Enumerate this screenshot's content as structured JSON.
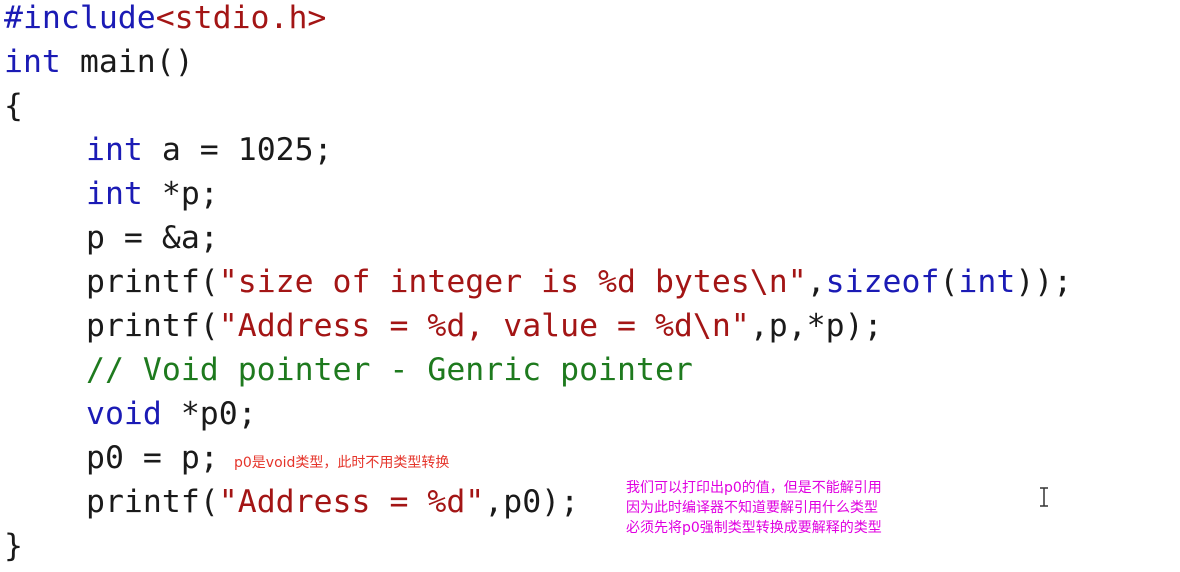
{
  "code": {
    "l1": {
      "directive": "#include",
      "header": "<stdio.h>"
    },
    "l2": {
      "kw": "int",
      "rest": " main()"
    },
    "l3": {
      "text": "{"
    },
    "l4": {
      "kw": "int",
      "rest": " a = 1025;"
    },
    "l5": {
      "kw": "int",
      "rest": " *p;"
    },
    "l6": {
      "text": "p = &a;"
    },
    "l7": {
      "fn": "printf(",
      "str": "\"size of integer is %d bytes\\n\"",
      "mid": ",",
      "kw1": "sizeof",
      "mid2": "(",
      "kw2": "int",
      "end": "));"
    },
    "l8": {
      "fn": "printf(",
      "str": "\"Address = %d, value = %d\\n\"",
      "end": ",p,*p);"
    },
    "l9": {
      "comment": "// Void pointer - Genric pointer"
    },
    "l10": {
      "kw": "void",
      "rest": " *p0;"
    },
    "l11": {
      "text": "p0 = p;"
    },
    "l12": {
      "fn": "printf(",
      "str": "\"Address = %d\"",
      "end": ",p0);"
    },
    "l13": {
      "text": "}"
    }
  },
  "annotations": {
    "red": "p0是void类型，此时不用类型转换",
    "magenta": [
      "我们可以打印出p0的值，但是不能解引用",
      "因为此时编译器不知道要解引用什么类型",
      "必须先将p0强制类型转换成要解释的类型"
    ]
  },
  "colors": {
    "keyword": "#1b1bb5",
    "string": "#a31515",
    "comment": "#1e7a1e",
    "note_red": "#e5352b",
    "note_magenta": "#e000e0"
  },
  "cursor": {
    "icon": "text-ibeam-cursor-icon"
  }
}
